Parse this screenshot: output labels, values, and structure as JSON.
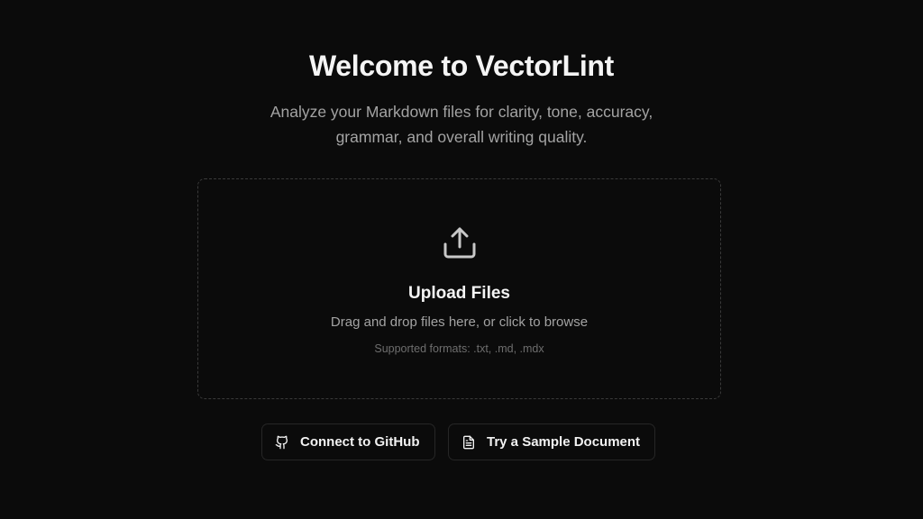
{
  "header": {
    "title": "Welcome to VectorLint",
    "subtitle": "Analyze your Markdown files for clarity, tone, accuracy, grammar, and overall writing quality."
  },
  "upload": {
    "icon": "upload-icon",
    "title": "Upload Files",
    "description": "Drag and drop files here, or click to browse",
    "formats": "Supported formats: .txt, .md, .mdx"
  },
  "actions": {
    "github": {
      "label": "Connect to GitHub",
      "icon": "github-icon"
    },
    "sample": {
      "label": "Try a Sample Document",
      "icon": "document-icon"
    }
  },
  "colors": {
    "background": "#0b0b0b",
    "text": "#f5f5f5",
    "muted": "#a3a3a3",
    "border": "#3a3a3a"
  }
}
